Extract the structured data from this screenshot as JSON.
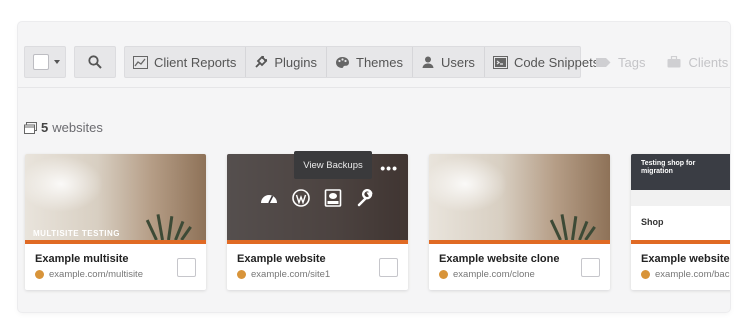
{
  "toolbar": {
    "actions": [
      {
        "label": "Client Reports",
        "icon": "chart-icon"
      },
      {
        "label": "Plugins",
        "icon": "plug-icon"
      },
      {
        "label": "Themes",
        "icon": "palette-icon"
      },
      {
        "label": "Users",
        "icon": "user-icon"
      },
      {
        "label": "Code Snippets",
        "icon": "code-icon"
      }
    ],
    "filters": [
      {
        "label": "Tags",
        "icon": "tag-icon"
      },
      {
        "label": "Clients",
        "icon": "briefcase-icon"
      }
    ]
  },
  "summary": {
    "count": "5",
    "label": "websites"
  },
  "sites": [
    {
      "name": "Example multisite",
      "url": "example.com/multisite",
      "thumb_label": "MULTISITE TESTING"
    },
    {
      "name": "Example website",
      "url": "example.com/site1",
      "tooltip": "View Backups",
      "menu": "•••"
    },
    {
      "name": "Example website clone",
      "url": "example.com/clone"
    },
    {
      "name": "Example website backup",
      "url": "example.com/backup",
      "thumb_hero": "Testing shop for migration",
      "thumb_title": "Shop"
    }
  ],
  "colors": {
    "accent": "#e06a24",
    "panel": "#f5f5f6",
    "toolbar_button": "#e7e7e9"
  }
}
